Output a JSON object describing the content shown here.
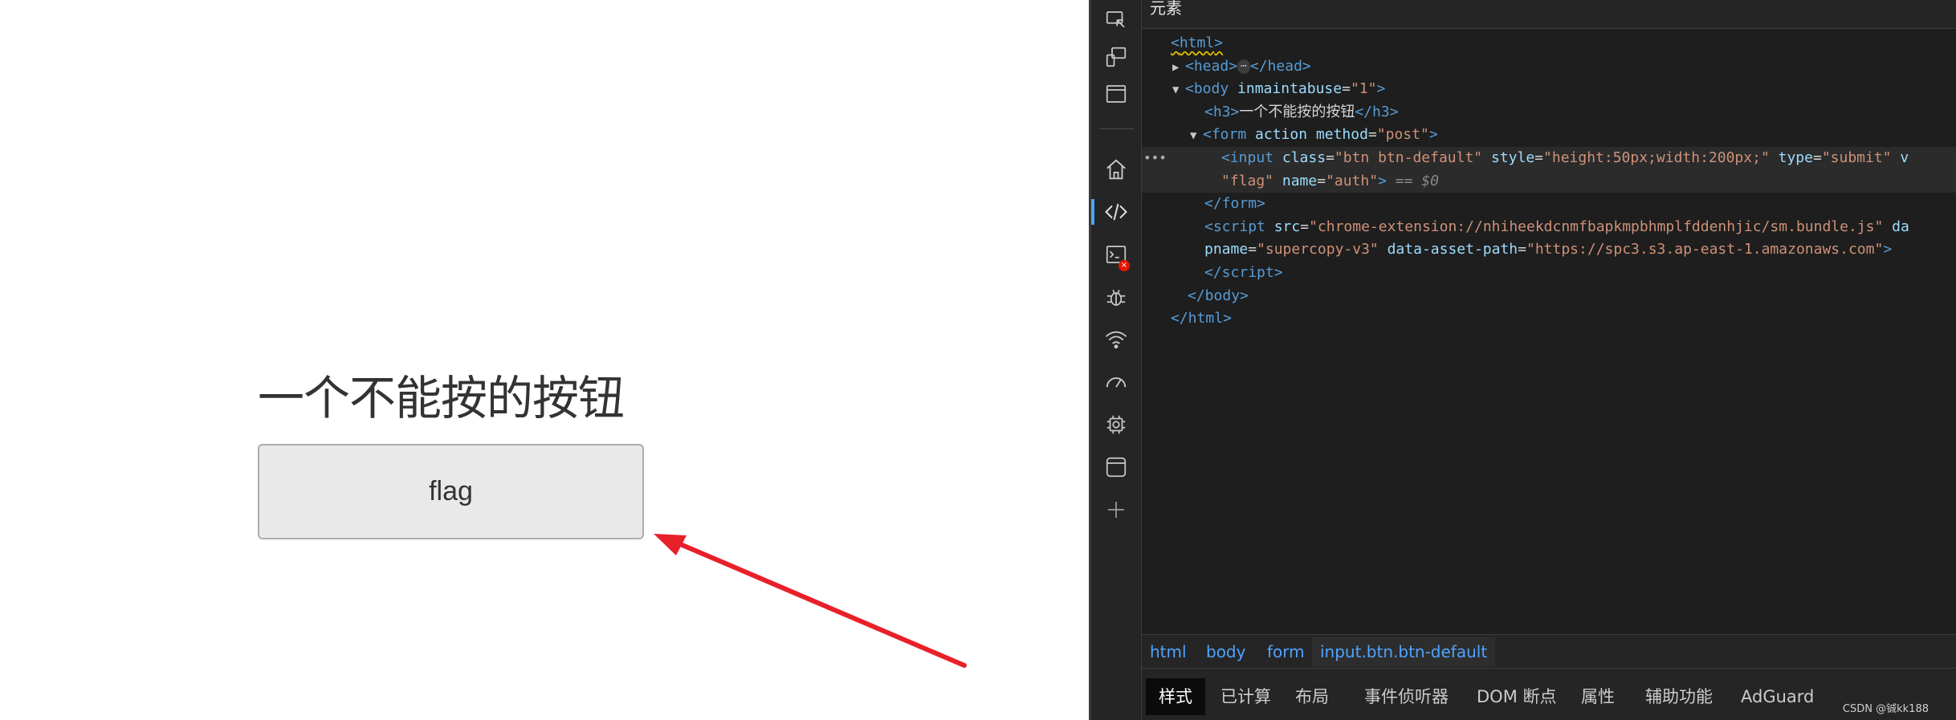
{
  "page": {
    "heading": "一个不能按的按钮",
    "flag_button": {
      "value": "flag"
    }
  },
  "colors": {
    "annotation_arrow": "#e8202a",
    "devtools_bg": "#1e1e1e",
    "tag": "#569cd6",
    "attr": "#9cdcfe",
    "value": "#ce9178",
    "link": "#4fa3ff"
  },
  "devtools": {
    "panel_title": "元素",
    "activity_icons": [
      "inspect-icon",
      "device-emulation-icon",
      "window-icon",
      "home-icon",
      "elements-icon",
      "console-icon",
      "debugger-icon",
      "network-icon",
      "performance-icon",
      "memory-icon",
      "application-icon",
      "add-icon"
    ],
    "console_error_badge": "×",
    "dom": {
      "html_open": "html",
      "head_tag": "head",
      "head_close": "/head",
      "ellipsis": "⋯",
      "body_tag": "body",
      "body_attr": "inmaintabuse",
      "body_attr_val": "\"1\"",
      "h3_tag": "h3",
      "h3_text": "一个不能按的按钮",
      "h3_close": "/h3",
      "form_tag": "form",
      "form_attr_action": "action",
      "form_attr_method": "method",
      "form_method_val": "\"post\"",
      "selected_dots": "•••",
      "input_tag": "input",
      "input_class_attr": "class",
      "input_class_val": "\"btn btn-default\"",
      "input_style_attr": "style",
      "input_style_val": "\"height:50px;width:200px;\"",
      "input_type_attr": "type",
      "input_type_val": "\"submit\"",
      "input_trunc": "v",
      "input_value_val": "\"flag\"",
      "input_name_attr": "name",
      "input_name_val": "\"auth\"",
      "selected_marker": "== $0",
      "form_close": "/form",
      "script_tag": "script",
      "script_src_attr": "src",
      "script_src_val": "\"chrome-extension://nhiheekdcnmfbapkmpbhmplfddenhjic/sm.bundle.js\"",
      "script_trunc": "da",
      "script_pname_attr": "pname",
      "script_pname_val": "\"supercopy-v3\"",
      "script_asset_attr": "data-asset-path",
      "script_asset_val": "\"https://spc3.s3.ap-east-1.amazonaws.com\"",
      "script_close": "/script",
      "body_close": "/body",
      "html_close": "/html"
    },
    "breadcrumbs": [
      "html",
      "body",
      "form",
      "input.btn.btn-default"
    ],
    "subtabs": [
      "样式",
      "已计算",
      "布局",
      "事件侦听器",
      "DOM 断点",
      "属性",
      "辅助功能",
      "AdGuard"
    ],
    "watermark": "CSDN @铖kk188"
  }
}
